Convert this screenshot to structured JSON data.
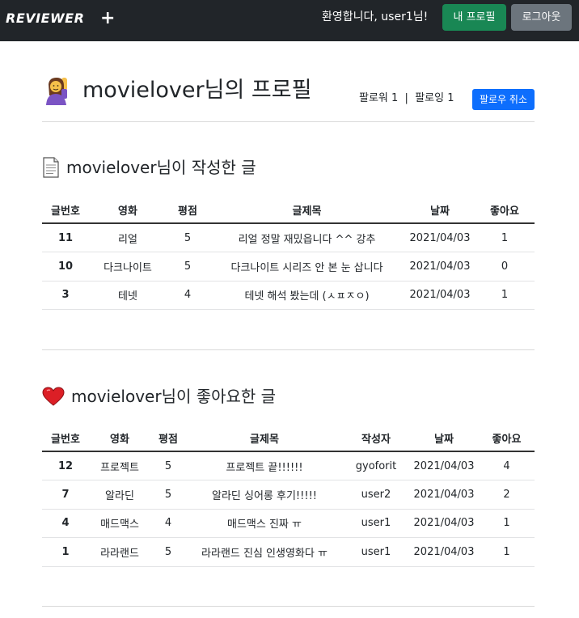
{
  "navbar": {
    "brand": "REVIEWER",
    "add_icon": "+",
    "welcome": "환영합니다, user1님!",
    "profile_button": "내 프로필",
    "logout_button": "로그아웃"
  },
  "profile": {
    "icon": "person-raising-hand-icon",
    "title": "movielover님의 프로필",
    "follow_info": "팔로워 1  |  팔로잉 1",
    "unfollow_button": "팔로우 취소"
  },
  "written_section": {
    "icon": "page-icon",
    "title": "movielover님이 작성한 글",
    "columns": [
      "글번호",
      "영화",
      "평점",
      "글제목",
      "날짜",
      "좋아요"
    ],
    "rows": [
      {
        "id": "11",
        "movie": "리얼",
        "rating": "5",
        "title": "리얼 정말 재밌읍니다 ^^ 강추",
        "date": "2021/04/03",
        "likes": "1"
      },
      {
        "id": "10",
        "movie": "다크나이트",
        "rating": "5",
        "title": "다크나이트 시리즈 안 본 눈 삽니다",
        "date": "2021/04/03",
        "likes": "0"
      },
      {
        "id": "3",
        "movie": "테넷",
        "rating": "4",
        "title": "테넷 해석 봤는데 (ㅅㅍㅈㅇ)",
        "date": "2021/04/03",
        "likes": "1"
      }
    ]
  },
  "liked_section": {
    "icon": "heart-icon",
    "title": "movielover님이 좋아요한 글",
    "columns": [
      "글번호",
      "영화",
      "평점",
      "글제목",
      "작성자",
      "날짜",
      "좋아요"
    ],
    "rows": [
      {
        "id": "12",
        "movie": "프로젝트",
        "rating": "5",
        "title": "프로젝트 끝!!!!!!",
        "author": "gyoforit",
        "date": "2021/04/03",
        "likes": "4"
      },
      {
        "id": "7",
        "movie": "알라딘",
        "rating": "5",
        "title": "알라딘 싱어롱 후기!!!!!",
        "author": "user2",
        "date": "2021/04/03",
        "likes": "2"
      },
      {
        "id": "4",
        "movie": "매드맥스",
        "rating": "4",
        "title": "매드맥스 진짜 ㅠ",
        "author": "user1",
        "date": "2021/04/03",
        "likes": "1"
      },
      {
        "id": "1",
        "movie": "라라랜드",
        "rating": "5",
        "title": "라라랜드 진심 인생영화다 ㅠ",
        "author": "user1",
        "date": "2021/04/03",
        "likes": "1"
      }
    ]
  },
  "colors": {
    "navbar_bg": "#212529",
    "profile_button": "#198754",
    "logout_button": "#6c757d",
    "unfollow_button": "#0d6efd",
    "heart": "#dc1f26"
  }
}
